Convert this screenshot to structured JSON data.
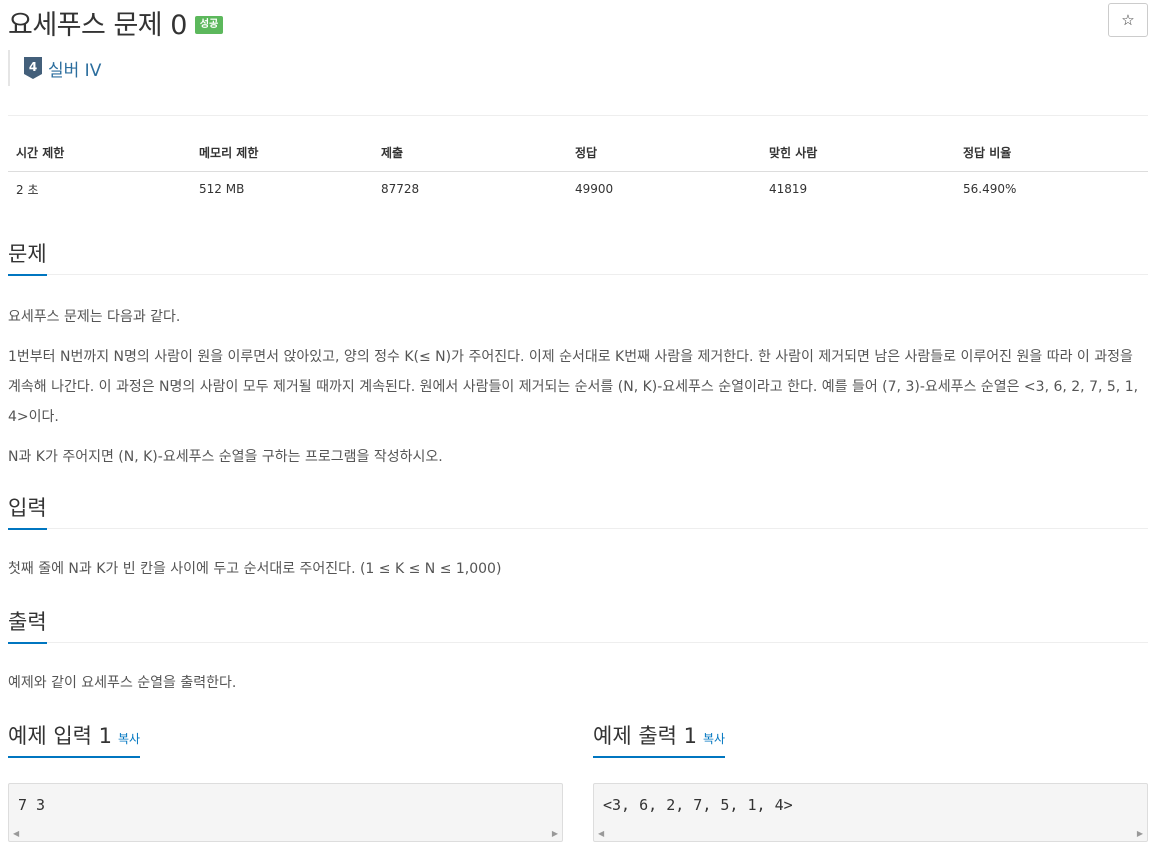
{
  "header": {
    "title": "요세푸스 문제 0",
    "result_badge": "성공",
    "star_icon": "☆",
    "tier_number": "4",
    "tier_label": "실버 IV"
  },
  "info_table": {
    "headers": [
      "시간 제한",
      "메모리 제한",
      "제출",
      "정답",
      "맞힌 사람",
      "정답 비율"
    ],
    "values": [
      "2 초",
      "512 MB",
      "87728",
      "49900",
      "41819",
      "56.490%"
    ]
  },
  "problem": {
    "heading": "문제",
    "paragraphs": [
      "요세푸스 문제는 다음과 같다.",
      "1번부터 N번까지 N명의 사람이 원을 이루면서 앉아있고, 양의 정수 K(≤ N)가 주어진다. 이제 순서대로 K번째 사람을 제거한다. 한 사람이 제거되면 남은 사람들로 이루어진 원을 따라 이 과정을 계속해 나간다. 이 과정은 N명의 사람이 모두 제거될 때까지 계속된다. 원에서 사람들이 제거되는 순서를 (N, K)-요세푸스 순열이라고 한다. 예를 들어 (7, 3)-요세푸스 순열은 <3, 6, 2, 7, 5, 1, 4>이다.",
      "N과 K가 주어지면 (N, K)-요세푸스 순열을 구하는 프로그램을 작성하시오."
    ]
  },
  "input_section": {
    "heading": "입력",
    "text": "첫째 줄에 N과 K가 빈 칸을 사이에 두고 순서대로 주어진다. (1 ≤ K ≤ N ≤ 1,000)"
  },
  "output_section": {
    "heading": "출력",
    "text": "예제와 같이 요세푸스 순열을 출력한다."
  },
  "samples": {
    "input_title": "예제 입력 1",
    "input_copy": "복사",
    "input_value": "7 3",
    "output_title": "예제 출력 1",
    "output_copy": "복사",
    "output_value": "<3, 6, 2, 7, 5, 1, 4>"
  },
  "colors": {
    "accent": "#0076c0",
    "badge_success": "#5cb85c",
    "tier_silver": "#435f7a"
  }
}
